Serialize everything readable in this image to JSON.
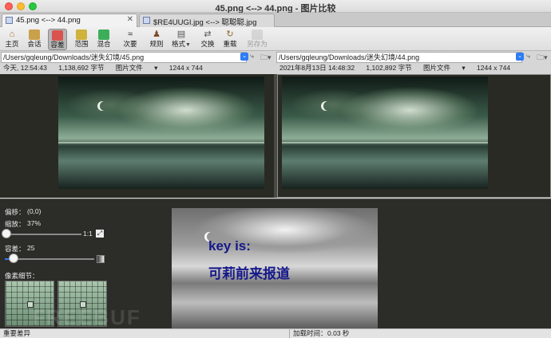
{
  "window": {
    "title": "45.png <--> 44.png - 图片比较"
  },
  "tabs": [
    {
      "label": "45.png <--> 44.png",
      "close": "✕"
    },
    {
      "label": "$RE4UUGI.jpg <--> 聪聪聪.jpg",
      "close": ""
    }
  ],
  "toolbar": {
    "items": [
      {
        "label": "主页",
        "icon": "home-icon"
      },
      {
        "label": "会话",
        "icon": "session-icon"
      },
      {
        "label": "容差",
        "icon": "tolerance-icon"
      },
      {
        "label": "范围",
        "icon": "range-icon"
      },
      {
        "label": "混合",
        "icon": "blend-icon"
      },
      {
        "label": "次要",
        "icon": "minor-icon"
      },
      {
        "label": "规则",
        "icon": "rules-icon"
      },
      {
        "label": "格式",
        "icon": "format-icon"
      },
      {
        "label": "交换",
        "icon": "swap-icon"
      },
      {
        "label": "重载",
        "icon": "reload-icon"
      },
      {
        "label": "另存为",
        "icon": "save-as-icon"
      }
    ]
  },
  "left": {
    "path": "/Users/gqleung/Downloads/迷失幻境/45.png",
    "date": "今天, 12:54:43",
    "size": "1,138,692 字节",
    "type": "图片文件",
    "dims": "1244 x 744"
  },
  "right": {
    "path": "/Users/gqleung/Downloads/迷失幻境/44.png",
    "date": "2021年8月13日 14:48:32",
    "size": "1,102,892 字节",
    "type": "图片文件",
    "dims": "1244 x 744"
  },
  "controls": {
    "offset_label": "偏移：",
    "offset_value": "(0,0)",
    "zoom_label": "缩放：",
    "zoom_value": "37%",
    "zoom_fit_label": "1:1",
    "tolerance_label": "容差：",
    "tolerance_value": "25",
    "zoom_fraction": 0.0,
    "tolerance_fraction": 0.1,
    "pixel_detail_label": "像素细节："
  },
  "overlay": {
    "line1": "key is:",
    "line2": "可莉前来报道"
  },
  "watermark": "FREEBUF",
  "status": {
    "left": "重要差异",
    "load_label": "加载时间：",
    "load_value": "0.03 秒"
  }
}
